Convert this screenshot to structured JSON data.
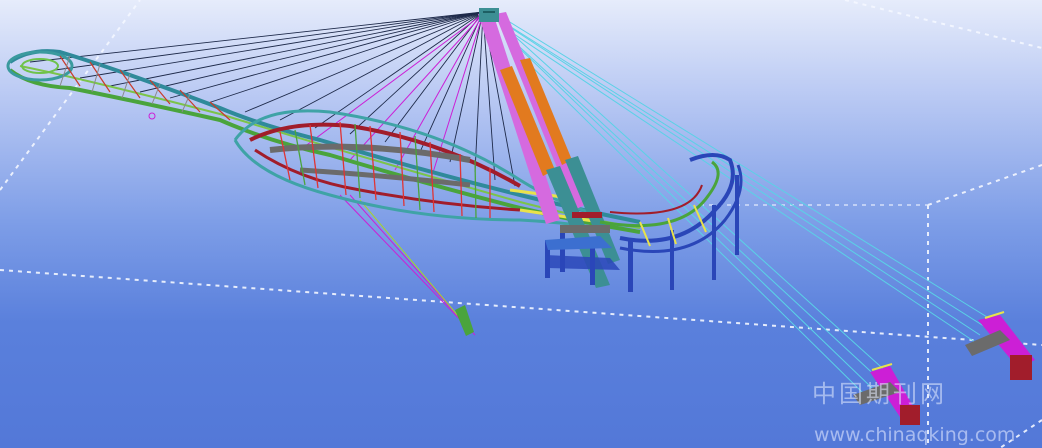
{
  "watermark": {
    "site_name_cn": "中国期刊网",
    "site_url": "www.chinaqking.com"
  },
  "colors": {
    "cable": "#1e2a4a",
    "stay_cable": "#5ad2e6",
    "pylon_upper": "#d56adf",
    "pylon_lower": "#e27a1f",
    "pylon_base": "#3c8f94",
    "deck_green": "#4aa43c",
    "girder_red": "#a11d2b",
    "beam_gray": "#6b6b6b",
    "column_blue": "#2a46b8",
    "magenta_line": "#cc1fd6"
  },
  "icons": [
    "bridge-model-icon",
    "anchor-frame-icon"
  ]
}
